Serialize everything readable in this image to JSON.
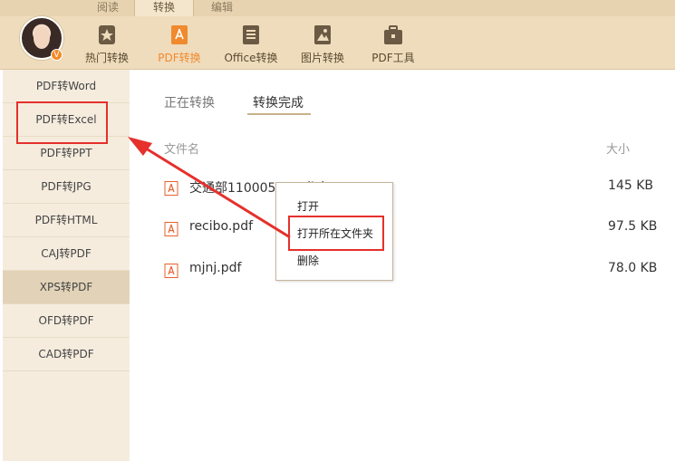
{
  "top_tabs": [
    "阅读",
    "转换",
    "编辑"
  ],
  "active_top_tab": 1,
  "avatar_badge": "V",
  "toolbar": [
    {
      "label": "热门转换",
      "icon": "star-badge-icon"
    },
    {
      "label": "PDF转换",
      "icon": "pdf-convert-icon"
    },
    {
      "label": "Office转换",
      "icon": "document-lines-icon"
    },
    {
      "label": "图片转换",
      "icon": "image-icon"
    },
    {
      "label": "PDF工具",
      "icon": "toolbox-icon"
    }
  ],
  "active_tool": 1,
  "sidebar": {
    "items": [
      "PDF转Word",
      "PDF转Excel",
      "PDF转PPT",
      "PDF转JPG",
      "PDF转HTML",
      "CAJ转PDF",
      "XPS转PDF",
      "OFD转PDF",
      "CAD转PDF"
    ],
    "selected": 6
  },
  "subtabs": [
    "正在转换",
    "转换完成"
  ],
  "active_subtab": 1,
  "table": {
    "columns": [
      "文件名",
      "大小"
    ],
    "rows": [
      {
        "name": "交通部110005651 龙安…df",
        "size": "145 KB"
      },
      {
        "name": "recibo.pdf",
        "size": "97.5 KB"
      },
      {
        "name": "mjnj.pdf",
        "size": "78.0 KB"
      }
    ]
  },
  "context_menu": [
    "打开",
    "打开所在文件夹",
    "删除"
  ],
  "colors": {
    "toolbar_bg": "#efdcbc",
    "accent_orange": "#f08a2e",
    "sidebar_bg": "#f5ecde",
    "annotation_red": "#e5302c",
    "pdf_icon": "#e7622b"
  }
}
